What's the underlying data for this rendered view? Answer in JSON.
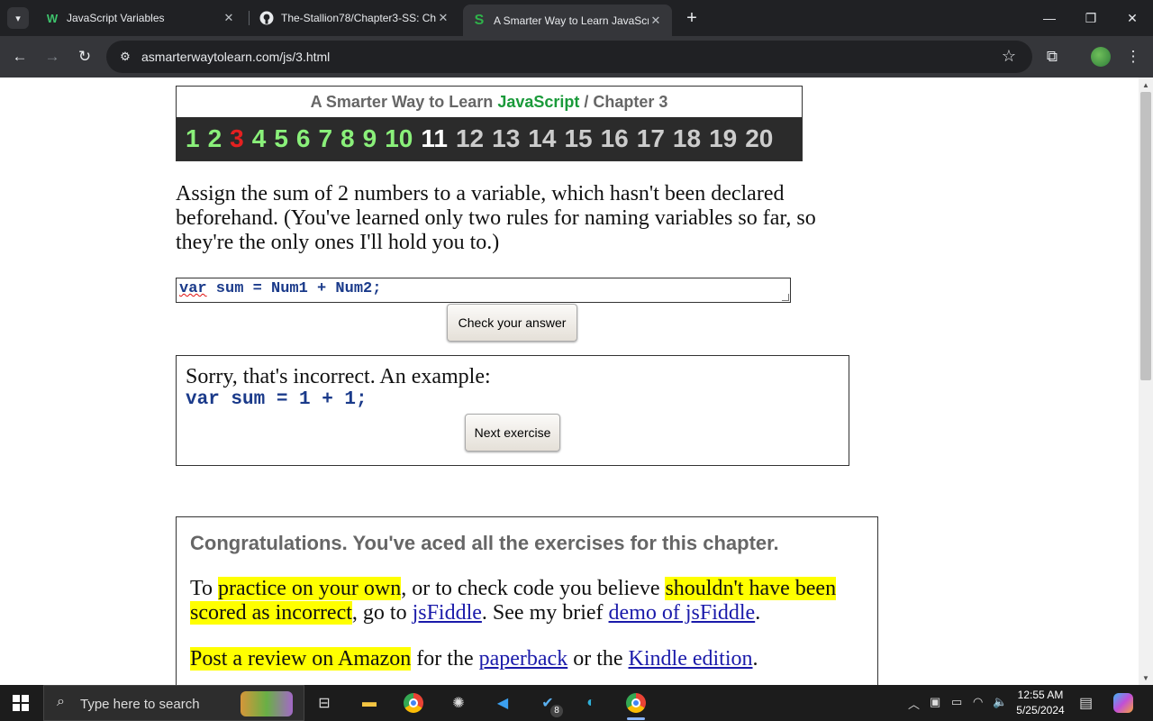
{
  "browser": {
    "tabs": [
      {
        "title": "JavaScript Variables",
        "favicon": "w"
      },
      {
        "title": "The-Stallion78/Chapter3-SS: Ch",
        "favicon": "github-icon"
      },
      {
        "title": "A Smarter Way to Learn JavaScr",
        "favicon": "S"
      }
    ],
    "url": "asmarterwaytolearn.com/js/3.html"
  },
  "page": {
    "header": {
      "prefix": "A Smarter Way to Learn ",
      "brand": "JavaScript",
      "separator": " / ",
      "chapter": "Chapter 3"
    },
    "exercise_numbers": [
      "1",
      "2",
      "3",
      "4",
      "5",
      "6",
      "7",
      "8",
      "9",
      "10",
      "11",
      "12",
      "13",
      "14",
      "15",
      "16",
      "17",
      "18",
      "19",
      "20"
    ],
    "current_exercise": "3",
    "question": "Assign the sum of 2 numbers to a variable, which hasn't been declared beforehand. (You've learned only two rules for naming variables so far, so they're the only ones I'll hold you to.)",
    "answer": {
      "keyword": "var",
      "rest": " sum = Num1 + Num2;"
    },
    "check_button": "Check your answer",
    "feedback": {
      "message": "Sorry, that's incorrect. An example:",
      "example": "var sum = 1 + 1;",
      "next_button": "Next exercise"
    },
    "congrats": {
      "heading": "Congratulations. You've aced all the exercises for this chapter.",
      "p1_a": "To ",
      "p1_hl1": "practice on your own",
      "p1_b": ", or to check code you believe ",
      "p1_hl2": "shouldn't have been scored as incorrect",
      "p1_c": ", go to ",
      "p1_link1": "jsFiddle",
      "p1_d": ". See my brief ",
      "p1_link2": "demo of jsFiddle",
      "p1_e": ".",
      "p2_hl": "Post a review on Amazon",
      "p2_a": " for the ",
      "p2_link1": "paperback",
      "p2_b": " or the ",
      "p2_link2": "Kindle edition",
      "p2_c": "."
    }
  },
  "taskbar": {
    "search_placeholder": "Type here to search",
    "badge_count": "8",
    "time": "12:55 AM",
    "date": "5/25/2024"
  }
}
